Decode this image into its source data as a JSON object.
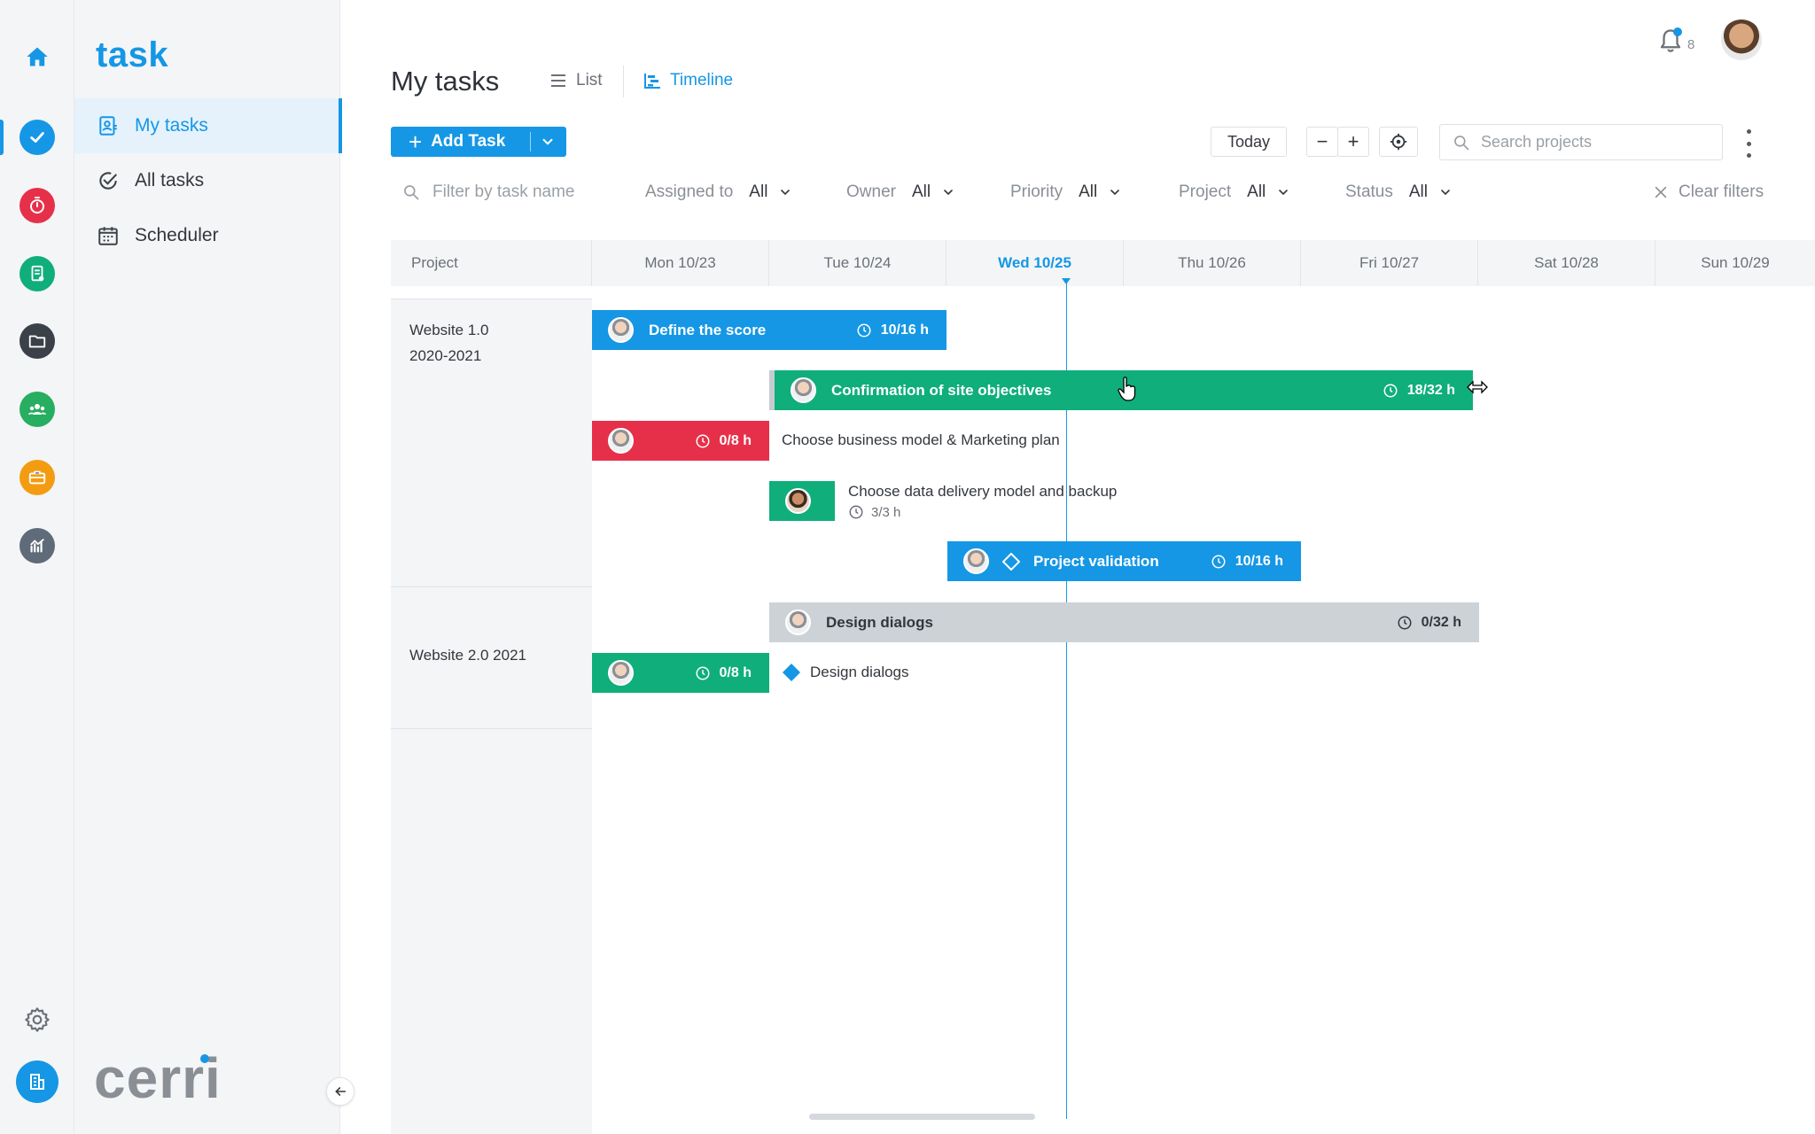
{
  "app": {
    "module_name": "task",
    "brand": "cerri"
  },
  "colors": {
    "accent": "#1597e5",
    "green": "#0fae7a",
    "red": "#e6304a",
    "grey": "#cdd2d7"
  },
  "rail": {
    "items": [
      {
        "icon": "home-icon",
        "color": "#1597e5"
      },
      {
        "icon": "checkmark-icon",
        "color": "#1597e5"
      },
      {
        "icon": "stopwatch-icon",
        "color": "#e6304a"
      },
      {
        "icon": "document-icon",
        "color": "#0fae7a"
      },
      {
        "icon": "folder-icon",
        "color": "#3b4148"
      },
      {
        "icon": "people-icon",
        "color": "#27ae60"
      },
      {
        "icon": "briefcase-icon",
        "color": "#f39c12"
      },
      {
        "icon": "analytics-icon",
        "color": "#5f6b78"
      },
      {
        "icon": "gear-icon",
        "color": "#6b7077"
      },
      {
        "icon": "building-icon",
        "color": "#1597e5"
      }
    ]
  },
  "nav": {
    "items": [
      {
        "label": "My tasks",
        "icon": "person-tasks-icon",
        "active": true
      },
      {
        "label": "All tasks",
        "icon": "check-circle-icon",
        "active": false
      },
      {
        "label": "Scheduler",
        "icon": "calendar-icon",
        "active": false
      }
    ]
  },
  "header": {
    "title": "My tasks",
    "views": [
      {
        "label": "List",
        "icon": "list-icon",
        "active": false
      },
      {
        "label": "Timeline",
        "icon": "timeline-icon",
        "active": true
      }
    ],
    "notifications_count": "8"
  },
  "toolbar": {
    "add_task_label": "Add Task",
    "today_label": "Today",
    "zoom_out": "−",
    "zoom_in": "+",
    "search_placeholder": "Search projects"
  },
  "filters": {
    "task_name_placeholder": "Filter by task name",
    "items": [
      {
        "label": "Assigned to",
        "value": "All"
      },
      {
        "label": "Owner",
        "value": "All"
      },
      {
        "label": "Priority",
        "value": "All"
      },
      {
        "label": "Project",
        "value": "All"
      },
      {
        "label": "Status",
        "value": "All"
      }
    ],
    "clear_label": "Clear filters"
  },
  "timeline": {
    "project_header": "Project",
    "days": [
      {
        "label": "Mon 10/23",
        "today": false
      },
      {
        "label": "Tue 10/24",
        "today": false
      },
      {
        "label": "Wed 10/25",
        "today": true
      },
      {
        "label": "Thu 10/26",
        "today": false
      },
      {
        "label": "Fri 10/27",
        "today": false
      },
      {
        "label": "Sat 10/28",
        "today": false
      },
      {
        "label": "Sun 10/29",
        "today": false
      }
    ],
    "projects": [
      {
        "name_line1": "Website 1.0",
        "name_line2": "2020-2021"
      },
      {
        "name_line1": "Website 2.0 2021",
        "name_line2": ""
      }
    ],
    "tasks": [
      {
        "title": "Define the score",
        "hours": "10/16 h",
        "color": "blue"
      },
      {
        "title": "Confirmation of site objectives",
        "hours": "18/32 h",
        "color": "green"
      },
      {
        "title": "Choose business model & Marketing plan",
        "hours": "0/8 h",
        "color": "red"
      },
      {
        "title": "Choose data delivery model and backup",
        "hours": "3/3 h",
        "color": "green"
      },
      {
        "title": "Project validation",
        "hours": "10/16 h",
        "color": "blue",
        "milestone": true
      },
      {
        "title": "Design dialogs",
        "hours": "0/32 h",
        "color": "grey"
      },
      {
        "title": "Design dialogs",
        "hours": "0/8 h",
        "color": "green",
        "milestone": true
      }
    ]
  }
}
